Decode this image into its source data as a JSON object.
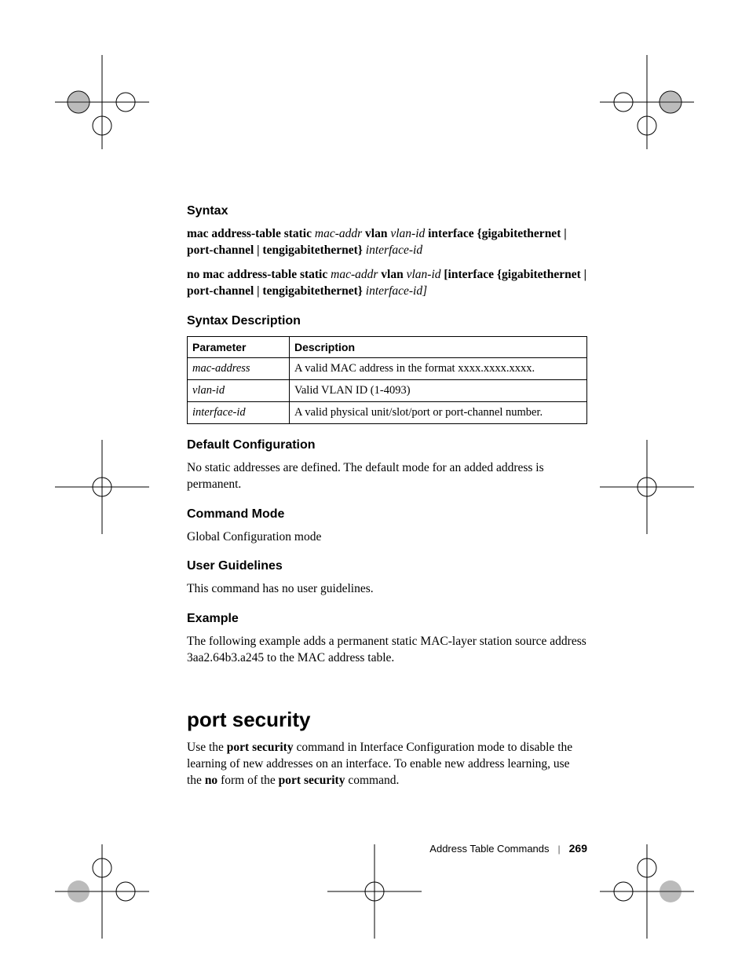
{
  "headings": {
    "syntax": "Syntax",
    "syntax_desc": "Syntax Description",
    "default_config": "Default Configuration",
    "command_mode": "Command Mode",
    "user_guidelines": "User Guidelines",
    "example": "Example",
    "section": "port security"
  },
  "syntax1": {
    "p1": "mac address-table static ",
    "i1": "mac-addr",
    "p2": " vlan ",
    "i2": "vlan-id",
    "p3": " interface {gigabitethernet | port-channel | tengigabitethernet} ",
    "i3": "interface-id"
  },
  "syntax2": {
    "p1": "no mac address-table static ",
    "i1": "mac-addr",
    "p2": " vlan ",
    "i2": "vlan-id",
    "p3": " [interface {gigabitethernet | port-channel | tengigabitethernet} ",
    "i3": "interface-id]"
  },
  "table": {
    "h1": "Parameter",
    "h2": "Description",
    "rows": [
      {
        "p": "mac-address",
        "d": "A valid MAC address in the format xxxx.xxxx.xxxx."
      },
      {
        "p": "vlan-id",
        "d": "Valid VLAN ID (1-4093)"
      },
      {
        "p": "interface-id",
        "d": "A valid physical unit/slot/port or port-channel number."
      }
    ]
  },
  "default_config_text": "No static addresses are defined. The default mode for an added address is permanent.",
  "command_mode_text": "Global Configuration mode",
  "user_guidelines_text": "This command has no user guidelines.",
  "example_text": "The following example adds a permanent static MAC-layer station source address 3aa2.64b3.a245 to the MAC address table.",
  "port_security": {
    "pre1": "Use the ",
    "b1": "port security",
    "mid1": " command in Interface Configuration mode to disable the learning of new addresses on an interface. To enable new address learning, use the ",
    "b2": "no",
    "mid2": " form of the ",
    "b3": "port security",
    "post": " command."
  },
  "footer": {
    "label": "Address Table Commands",
    "page": "269"
  }
}
